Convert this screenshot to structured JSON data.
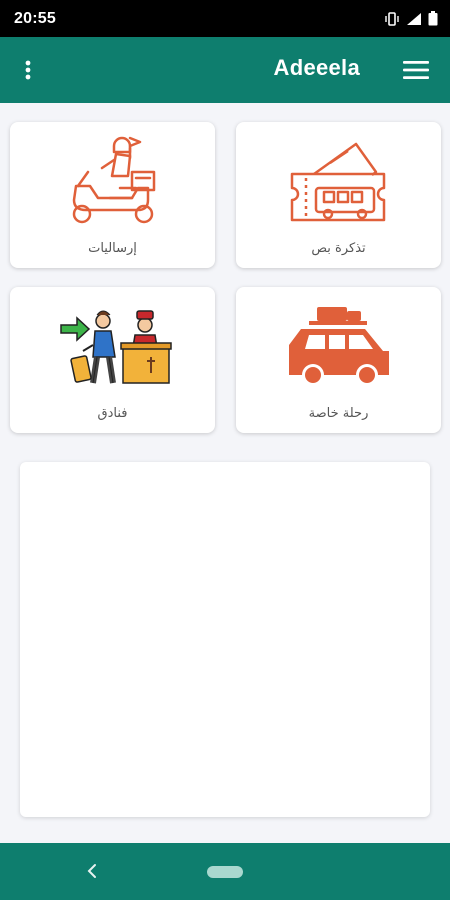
{
  "status_bar": {
    "time": "20:55",
    "icons": [
      "vibrate-icon",
      "signal-icon",
      "battery-icon"
    ]
  },
  "app_bar": {
    "title": "Adeeela",
    "left_icon": "more-vert-icon",
    "right_icon": "hamburger-menu-icon"
  },
  "services": {
    "parcels": {
      "label": "إرساليات",
      "icon": "scooter-delivery-icon"
    },
    "bus_ticket": {
      "label": "تذكرة بص",
      "icon": "bus-ticket-icon"
    },
    "hotels": {
      "label": "فنادق",
      "icon": "hotel-reception-icon"
    },
    "private_trip": {
      "label": "رحلة خاصة",
      "icon": "car-luggage-icon"
    }
  },
  "colors": {
    "primary": "#0e7e6e",
    "accent": "#e0603a",
    "background": "#f4f5f9"
  }
}
